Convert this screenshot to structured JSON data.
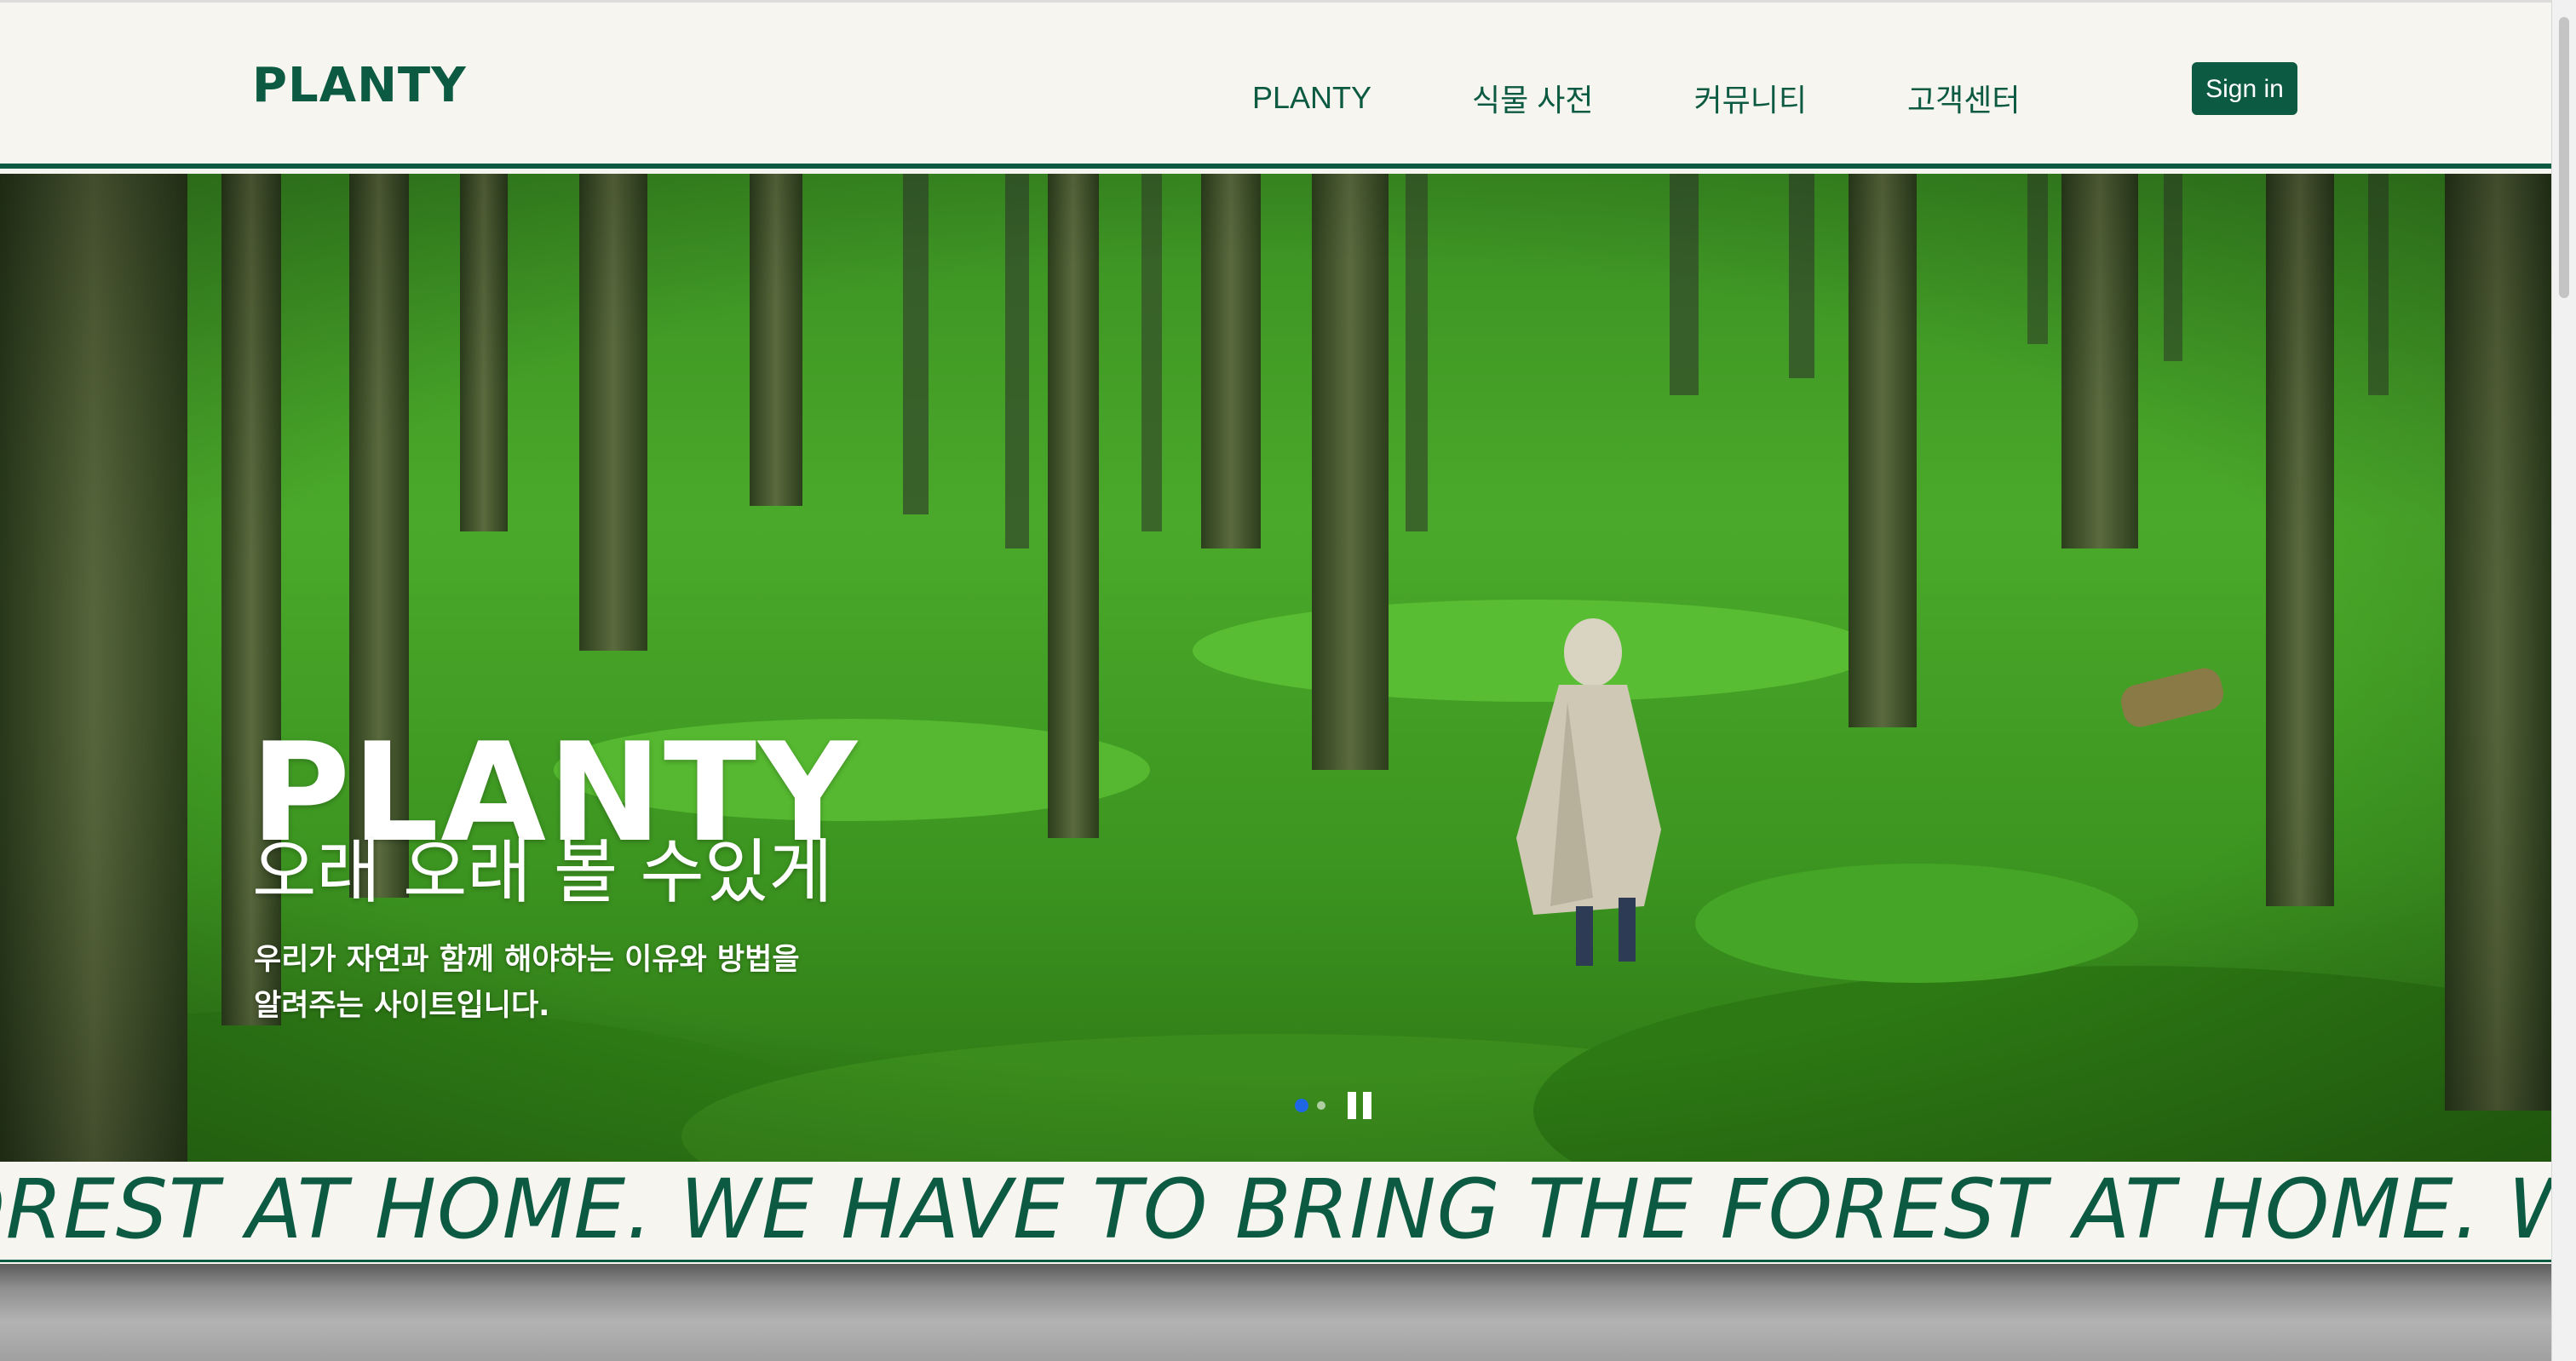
{
  "header": {
    "logo": "PLANTY",
    "nav": [
      "PLANTY",
      "식물 사전",
      "커뮤니티",
      "고객센터"
    ],
    "signin_label": "Sign in"
  },
  "hero": {
    "title": "PLANTY",
    "subtitle": "오래 오래 볼 수있게",
    "description_lines": [
      "우리가 자연과 함께 해야하는 이유와 방법을",
      "알려주는 사이트입니다."
    ],
    "slides": 2,
    "active_slide": 1
  },
  "marquee": {
    "text": "OREST AT HOME. WE HAVE TO BRING THE FOREST AT HOME. W"
  },
  "colors": {
    "brand": "#0c5a41",
    "background": "#f6f5f0",
    "active_dot": "#1f66e5"
  },
  "icons": [
    "pause-icon"
  ]
}
